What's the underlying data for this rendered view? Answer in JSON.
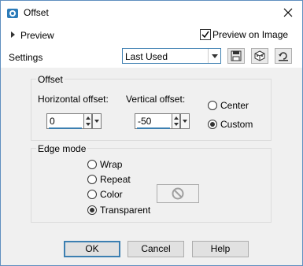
{
  "window": {
    "title": "Offset"
  },
  "preview": {
    "label": "Preview",
    "preview_on_image_label": "Preview on Image",
    "preview_on_image_checked": true
  },
  "settings": {
    "label": "Settings",
    "selected": "Last Used"
  },
  "offset": {
    "group_label": "Offset",
    "horizontal_label": "Horizontal offset:",
    "horizontal_value": "0",
    "vertical_label": "Vertical offset:",
    "vertical_value": "-50",
    "center_label": "Center",
    "custom_label": "Custom",
    "selected": "Custom"
  },
  "edge_mode": {
    "group_label": "Edge mode",
    "options": [
      "Wrap",
      "Repeat",
      "Color",
      "Transparent"
    ],
    "selected": "Transparent"
  },
  "buttons": {
    "ok": "OK",
    "cancel": "Cancel",
    "help": "Help"
  },
  "icons": [
    "app-icon",
    "close-icon",
    "save-icon",
    "randomize-icon",
    "reset-icon",
    "no-color-icon"
  ],
  "colors": {
    "accent": "#3c7fb1"
  }
}
